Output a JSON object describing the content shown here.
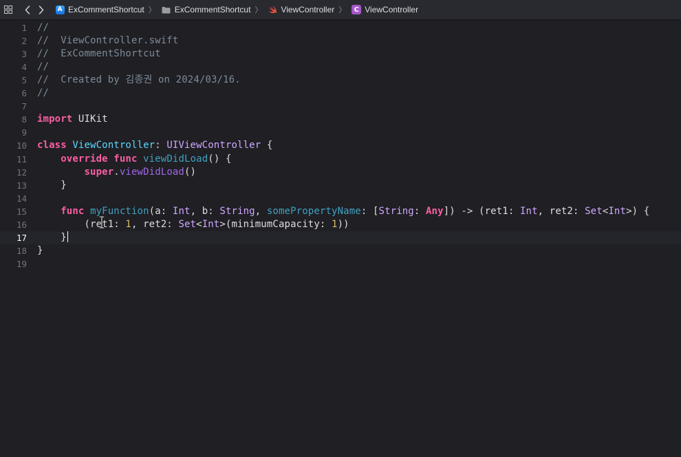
{
  "breadcrumbs": [
    {
      "label": "ExCommentShortcut",
      "icon": "app-icon"
    },
    {
      "label": "ExCommentShortcut",
      "icon": "folder-icon"
    },
    {
      "label": "ViewController",
      "icon": "swift-icon"
    },
    {
      "label": "ViewController",
      "icon": "class-icon",
      "badge": "C"
    }
  ],
  "colors": {
    "background": "#1f1f24",
    "jumpbar": "#292a30",
    "current_line": "#23252b",
    "comment": "#7f8c98",
    "keyword": "#fc5fa3",
    "type": "#5dd8ff",
    "system_type": "#d0a8ff",
    "function_decl": "#41a1c0",
    "number": "#d0bf69"
  },
  "editor": {
    "current_line": 17,
    "lines": [
      {
        "n": "1",
        "tokens": [
          {
            "t": "//",
            "c": "comment"
          }
        ]
      },
      {
        "n": "2",
        "tokens": [
          {
            "t": "//  ViewController.swift",
            "c": "comment"
          }
        ]
      },
      {
        "n": "3",
        "tokens": [
          {
            "t": "//  ExCommentShortcut",
            "c": "comment"
          }
        ]
      },
      {
        "n": "4",
        "tokens": [
          {
            "t": "//",
            "c": "comment"
          }
        ]
      },
      {
        "n": "5",
        "tokens": [
          {
            "t": "//  Created by 김종권 on 2024/03/16.",
            "c": "comment"
          }
        ]
      },
      {
        "n": "6",
        "tokens": [
          {
            "t": "//",
            "c": "comment"
          }
        ]
      },
      {
        "n": "7",
        "tokens": []
      },
      {
        "n": "8",
        "tokens": [
          {
            "t": "import",
            "c": "keyword"
          },
          {
            "t": " UIKit",
            "c": "plain"
          }
        ]
      },
      {
        "n": "9",
        "tokens": []
      },
      {
        "n": "10",
        "tokens": [
          {
            "t": "class",
            "c": "keyword"
          },
          {
            "t": " ",
            "c": "plain"
          },
          {
            "t": "ViewController",
            "c": "type"
          },
          {
            "t": ": ",
            "c": "plain"
          },
          {
            "t": "UIViewController",
            "c": "systype"
          },
          {
            "t": " {",
            "c": "plain"
          }
        ]
      },
      {
        "n": "11",
        "tokens": [
          {
            "t": "    ",
            "c": "plain"
          },
          {
            "t": "override",
            "c": "keyword"
          },
          {
            "t": " ",
            "c": "plain"
          },
          {
            "t": "func",
            "c": "keyword"
          },
          {
            "t": " ",
            "c": "plain"
          },
          {
            "t": "viewDidLoad",
            "c": "decl"
          },
          {
            "t": "() {",
            "c": "plain"
          }
        ]
      },
      {
        "n": "12",
        "tokens": [
          {
            "t": "        ",
            "c": "plain"
          },
          {
            "t": "super",
            "c": "keyword"
          },
          {
            "t": ".",
            "c": "plain"
          },
          {
            "t": "viewDidLoad",
            "c": "sysfunc"
          },
          {
            "t": "()",
            "c": "plain"
          }
        ]
      },
      {
        "n": "13",
        "tokens": [
          {
            "t": "    }",
            "c": "plain"
          }
        ]
      },
      {
        "n": "14",
        "tokens": []
      },
      {
        "n": "15",
        "tokens": [
          {
            "t": "    ",
            "c": "plain"
          },
          {
            "t": "func",
            "c": "keyword"
          },
          {
            "t": " ",
            "c": "plain"
          },
          {
            "t": "myFunction",
            "c": "decl"
          },
          {
            "t": "(a: ",
            "c": "plain"
          },
          {
            "t": "Int",
            "c": "systype"
          },
          {
            "t": ", b: ",
            "c": "plain"
          },
          {
            "t": "String",
            "c": "systype"
          },
          {
            "t": ", ",
            "c": "plain"
          },
          {
            "t": "somePropertyName",
            "c": "decl"
          },
          {
            "t": ": [",
            "c": "plain"
          },
          {
            "t": "String",
            "c": "systype"
          },
          {
            "t": ": ",
            "c": "plain"
          },
          {
            "t": "Any",
            "c": "keyword"
          },
          {
            "t": "]) -> (ret1: ",
            "c": "plain"
          },
          {
            "t": "Int",
            "c": "systype"
          },
          {
            "t": ", ret2: ",
            "c": "plain"
          },
          {
            "t": "Set",
            "c": "systype"
          },
          {
            "t": "<",
            "c": "plain"
          },
          {
            "t": "Int",
            "c": "systype"
          },
          {
            "t": ">) {",
            "c": "plain"
          }
        ]
      },
      {
        "n": "16",
        "tokens": [
          {
            "t": "        (ret1: ",
            "c": "plain"
          },
          {
            "t": "1",
            "c": "number"
          },
          {
            "t": ", ret2: ",
            "c": "plain"
          },
          {
            "t": "Set",
            "c": "systype"
          },
          {
            "t": "<",
            "c": "plain"
          },
          {
            "t": "Int",
            "c": "systype"
          },
          {
            "t": ">(minimumCapacity: ",
            "c": "plain"
          },
          {
            "t": "1",
            "c": "number"
          },
          {
            "t": "))",
            "c": "plain"
          }
        ]
      },
      {
        "n": "17",
        "tokens": [
          {
            "t": "    }",
            "c": "plain"
          }
        ],
        "caret": true
      },
      {
        "n": "18",
        "tokens": [
          {
            "t": "}",
            "c": "plain"
          }
        ]
      },
      {
        "n": "19",
        "tokens": []
      }
    ]
  }
}
